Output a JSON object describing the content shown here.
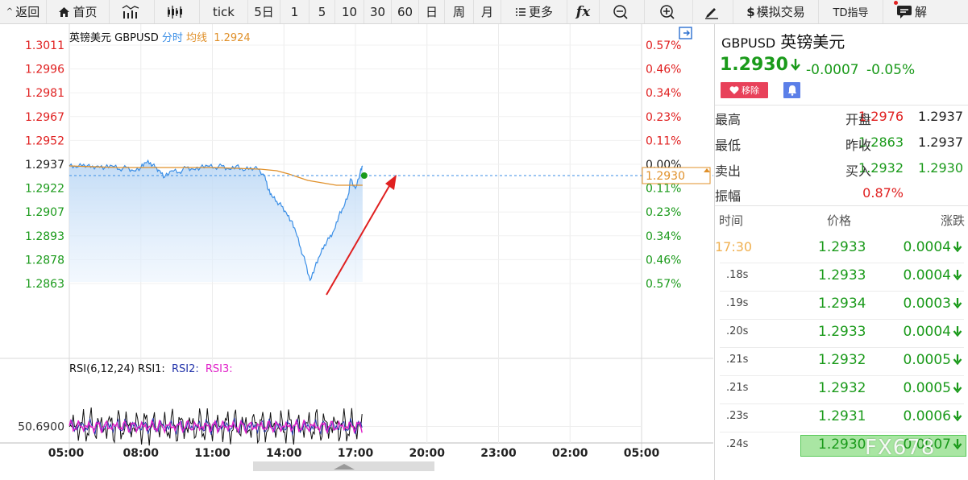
{
  "toolbar": {
    "items": [
      {
        "label": "返回",
        "icon": "back-caret-icon"
      },
      {
        "label": "首页",
        "icon": "home-icon"
      },
      {
        "label": "",
        "icon": "candlestick-chart-icon"
      },
      {
        "label": "",
        "icon": "ohlc-chart-icon"
      },
      {
        "label": "tick"
      },
      {
        "label": "5日"
      },
      {
        "label": "1"
      },
      {
        "label": "5"
      },
      {
        "label": "10"
      },
      {
        "label": "30"
      },
      {
        "label": "60"
      },
      {
        "label": "日"
      },
      {
        "label": "周"
      },
      {
        "label": "月"
      },
      {
        "label": "更多",
        "icon": "list-icon"
      },
      {
        "label": "fx",
        "icon": "formula-icon"
      },
      {
        "label": "",
        "icon": "zoom-out-icon"
      },
      {
        "label": "",
        "icon": "zoom-in-icon"
      },
      {
        "label": "",
        "icon": "pen-icon"
      },
      {
        "label": "模拟交易",
        "icon": "dollar-icon"
      },
      {
        "label": "TD指导"
      },
      {
        "label": "解",
        "icon": "chat-icon"
      }
    ]
  },
  "chart_header": {
    "name": "英镑美元 GBPUSD",
    "mode": "分时",
    "avg_label": "均线",
    "avg_value": "1.2924"
  },
  "rsi_header": {
    "label": "RSI(6,12,24)",
    "rsi1": "RSI1:",
    "rsi2": "RSI2:",
    "rsi3": "RSI3:",
    "axis_value": "50.6900"
  },
  "chart_data": {
    "type": "line",
    "prev_close": 1.2937,
    "ylim": [
      1.2863,
      1.3011
    ],
    "left_ticks": [
      "1.3011",
      "1.2996",
      "1.2981",
      "1.2967",
      "1.2952",
      "1.2937",
      "1.2922",
      "1.2907",
      "1.2893",
      "1.2878",
      "1.2863"
    ],
    "right_ticks": [
      "0.57%",
      "0.46%",
      "0.34%",
      "0.23%",
      "0.11%",
      "0.00%",
      "0.11%",
      "0.23%",
      "0.34%",
      "0.46%",
      "0.57%"
    ],
    "x_ticks": [
      "05:00",
      "08:00",
      "11:00",
      "14:00",
      "17:00",
      "20:00",
      "23:00",
      "02:00",
      "05:00"
    ],
    "current_price_label": "1.2930",
    "series": [
      {
        "type": "price",
        "x": [
          0,
          0.3,
          0.6,
          0.9,
          1.2,
          1.5,
          1.8,
          2.1,
          2.4,
          2.7,
          3.0,
          3.2,
          3.4,
          3.6,
          3.8,
          4.0,
          4.3,
          4.6,
          4.9,
          5.2,
          5.5,
          5.8,
          6.1,
          6.4,
          6.7,
          7.0,
          7.3,
          7.6,
          7.9,
          8.2,
          8.35,
          8.5,
          8.7,
          8.9,
          9.1,
          9.3,
          9.5,
          9.7,
          9.9,
          10.1,
          10.3,
          10.5,
          10.7,
          10.9,
          11.1,
          11.3,
          11.5,
          11.7,
          11.8,
          12.0,
          12.2,
          12.3
        ],
        "y": [
          1.2936,
          1.2935,
          1.2937,
          1.2935,
          1.2936,
          1.2935,
          1.2936,
          1.2934,
          1.2935,
          1.2933,
          1.2935,
          1.2938,
          1.2938,
          1.2935,
          1.2933,
          1.2929,
          1.2933,
          1.2932,
          1.2935,
          1.2934,
          1.2935,
          1.2936,
          1.2935,
          1.2936,
          1.2934,
          1.2936,
          1.2933,
          1.2935,
          1.2934,
          1.293,
          1.2921,
          1.2917,
          1.2914,
          1.2911,
          1.2907,
          1.2902,
          1.2895,
          1.2885,
          1.2876,
          1.2865,
          1.2873,
          1.288,
          1.2887,
          1.2891,
          1.2896,
          1.2905,
          1.291,
          1.2918,
          1.2928,
          1.2922,
          1.2932,
          1.2936
        ]
      },
      {
        "type": "average",
        "x": [
          0,
          2,
          4,
          6,
          8,
          8.7,
          9.2,
          9.6,
          10,
          10.4,
          10.8,
          11.2,
          11.6,
          12.0,
          12.3
        ],
        "y": [
          1.2936,
          1.2935,
          1.2935,
          1.2935,
          1.2934,
          1.2933,
          1.2931,
          1.2929,
          1.2927,
          1.2926,
          1.2925,
          1.2924,
          1.2924,
          1.2924,
          1.2924
        ]
      }
    ],
    "rsi_ylim": [
      0,
      100
    ],
    "rsi_level": 50.69,
    "colors": {
      "price": "#3a8ee6",
      "average": "#e0902a",
      "rsi1": "#111111",
      "rsi2": "#2233aa",
      "rsi3": "#e020c8",
      "up": "#e02020",
      "down": "#1a9a1a"
    }
  },
  "quote": {
    "code": "GBPUSD",
    "name": "英镑美元",
    "price": "1.2930",
    "change": "-0.0007",
    "change_pct": "-0.05%",
    "remove_label": "移除",
    "stats": [
      {
        "label": "最高",
        "value": "1.2976",
        "color": "#e02020"
      },
      {
        "label": "开盘",
        "value": "1.2937",
        "color": "#222222"
      },
      {
        "label": "最低",
        "value": "1.2863",
        "color": "#1a9a1a"
      },
      {
        "label": "昨收",
        "value": "1.2937",
        "color": "#222222"
      },
      {
        "label": "卖出",
        "value": "1.2932",
        "color": "#1a9a1a"
      },
      {
        "label": "买入",
        "value": "1.2930",
        "color": "#1a9a1a"
      },
      {
        "label": "振幅",
        "value": "0.87%",
        "color": "#e02020"
      }
    ],
    "trades_header": {
      "time": "时间",
      "price": "价格",
      "change": "涨跌"
    },
    "trades": [
      {
        "time": "17:30",
        "price": "1.2933",
        "change": "0.0004"
      },
      {
        "time": ".18s",
        "price": "1.2933",
        "change": "0.0004"
      },
      {
        "time": ".19s",
        "price": "1.2934",
        "change": "0.0003"
      },
      {
        "time": ".20s",
        "price": "1.2933",
        "change": "0.0004"
      },
      {
        "time": ".21s",
        "price": "1.2932",
        "change": "0.0005"
      },
      {
        "time": ".21s",
        "price": "1.2932",
        "change": "0.0005"
      },
      {
        "time": ".23s",
        "price": "1.2931",
        "change": "0.0006"
      },
      {
        "time": ".24s",
        "price": "1.2930",
        "change": "0.0007"
      }
    ]
  },
  "watermark": "FX678"
}
